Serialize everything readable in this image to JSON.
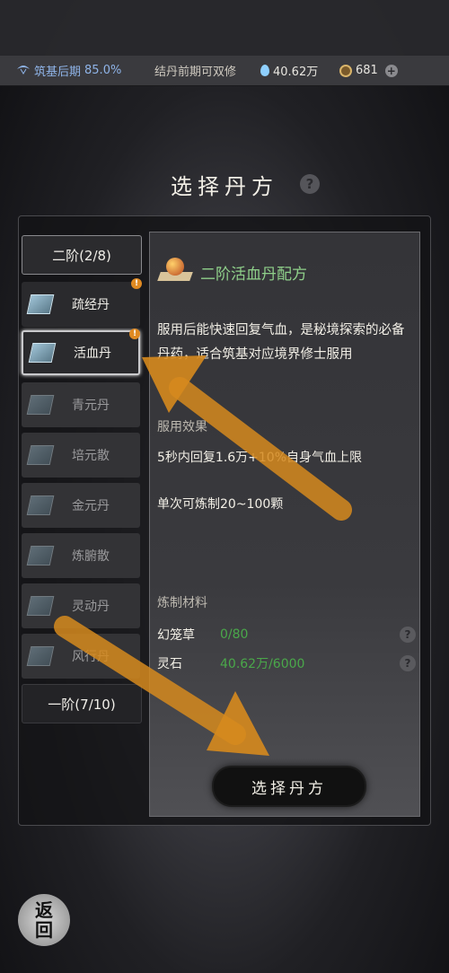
{
  "status": {
    "realm": "筑基后期",
    "progress": "85.0%",
    "hint": "结丹前期可双修",
    "spirit_stones": "40.62万",
    "coins": "681"
  },
  "title": "选择丹方",
  "tiers": [
    {
      "label": "二阶(2/8)"
    },
    {
      "label": "一阶(7/10)"
    }
  ],
  "recipes": [
    {
      "label": "疏经丹",
      "badge": "!"
    },
    {
      "label": "活血丹",
      "badge": "!"
    },
    {
      "label": "青元丹"
    },
    {
      "label": "培元散"
    },
    {
      "label": "金元丹"
    },
    {
      "label": "炼腑散"
    },
    {
      "label": "灵动丹"
    },
    {
      "label": "风行丹"
    }
  ],
  "detail": {
    "name": "二阶活血丹配方",
    "description": "服用后能快速回复气血，是秘境探索的必备丹药，适合筑基对应境界修士服用",
    "effect_label": "服用效果",
    "effect": "5秒内回复1.6万+10%自身气血上限",
    "yield": "单次可炼制20~100颗",
    "materials_label": "炼制材料",
    "materials": [
      {
        "name": "幻笼草",
        "value": "0/80"
      },
      {
        "name": "灵石",
        "value": "40.62万/6000"
      }
    ]
  },
  "select_button": "选择丹方",
  "back_button": {
    "line1": "返",
    "line2": "回"
  },
  "help": "?",
  "plus": "+"
}
